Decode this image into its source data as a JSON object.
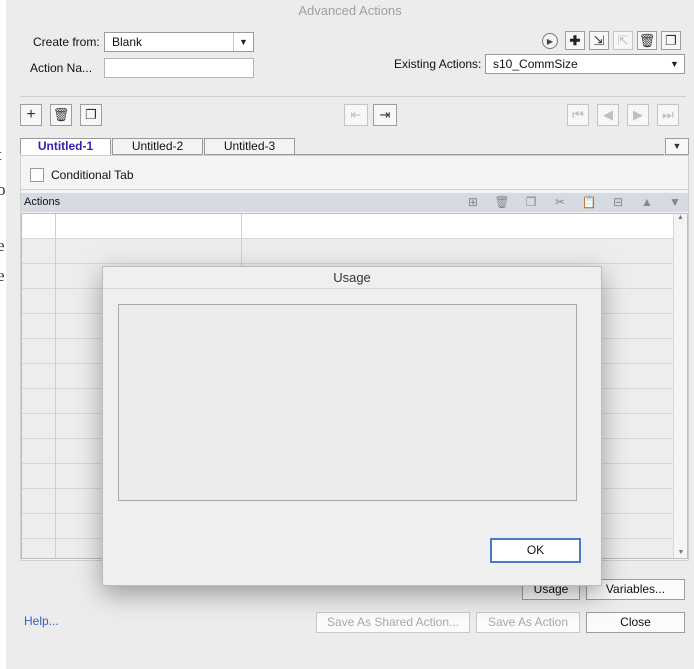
{
  "window": {
    "title": "Advanced Actions"
  },
  "left_strip": [
    "t",
    "o",
    "e",
    "e"
  ],
  "header": {
    "create_from_label": "Create from:",
    "create_from_value": "Blank",
    "action_name_label": "Action Na...",
    "action_name_value": "",
    "existing_actions_label": "Existing Actions:",
    "existing_actions_value": "s10_CommSize"
  },
  "toolbar_right_icons": [
    "play-icon",
    "add-icon",
    "import-icon",
    "export-icon",
    "delete-icon",
    "duplicate-icon"
  ],
  "toolbar2": {
    "left": [
      "add-icon",
      "trash-icon",
      "copy-icon"
    ],
    "mid": [
      "import-icon",
      "export-icon"
    ],
    "nav": [
      "first-icon",
      "previous-icon",
      "next-icon",
      "last-icon"
    ]
  },
  "tabs": [
    "Untitled-1",
    "Untitled-2",
    "Untitled-3"
  ],
  "conditional_tab_label": "Conditional Tab",
  "actions_header": "Actions",
  "actions_toolbar_icons": [
    "insert-row-icon",
    "delete-row-icon",
    "copy-row-icon",
    "cut-icon",
    "paste-icon",
    "insert-above-icon",
    "move-up-icon",
    "move-down-icon"
  ],
  "footer": {
    "help": "Help...",
    "usage": "Usage",
    "variables": "Variables...",
    "save_shared": "Save As Shared Action...",
    "save_action": "Save As Action",
    "close": "Close"
  },
  "dialog": {
    "title": "Usage",
    "ok": "OK"
  },
  "colors": {
    "accent": "#3a1fa8",
    "link": "#2d62c4",
    "focus": "#4a7cc4"
  }
}
